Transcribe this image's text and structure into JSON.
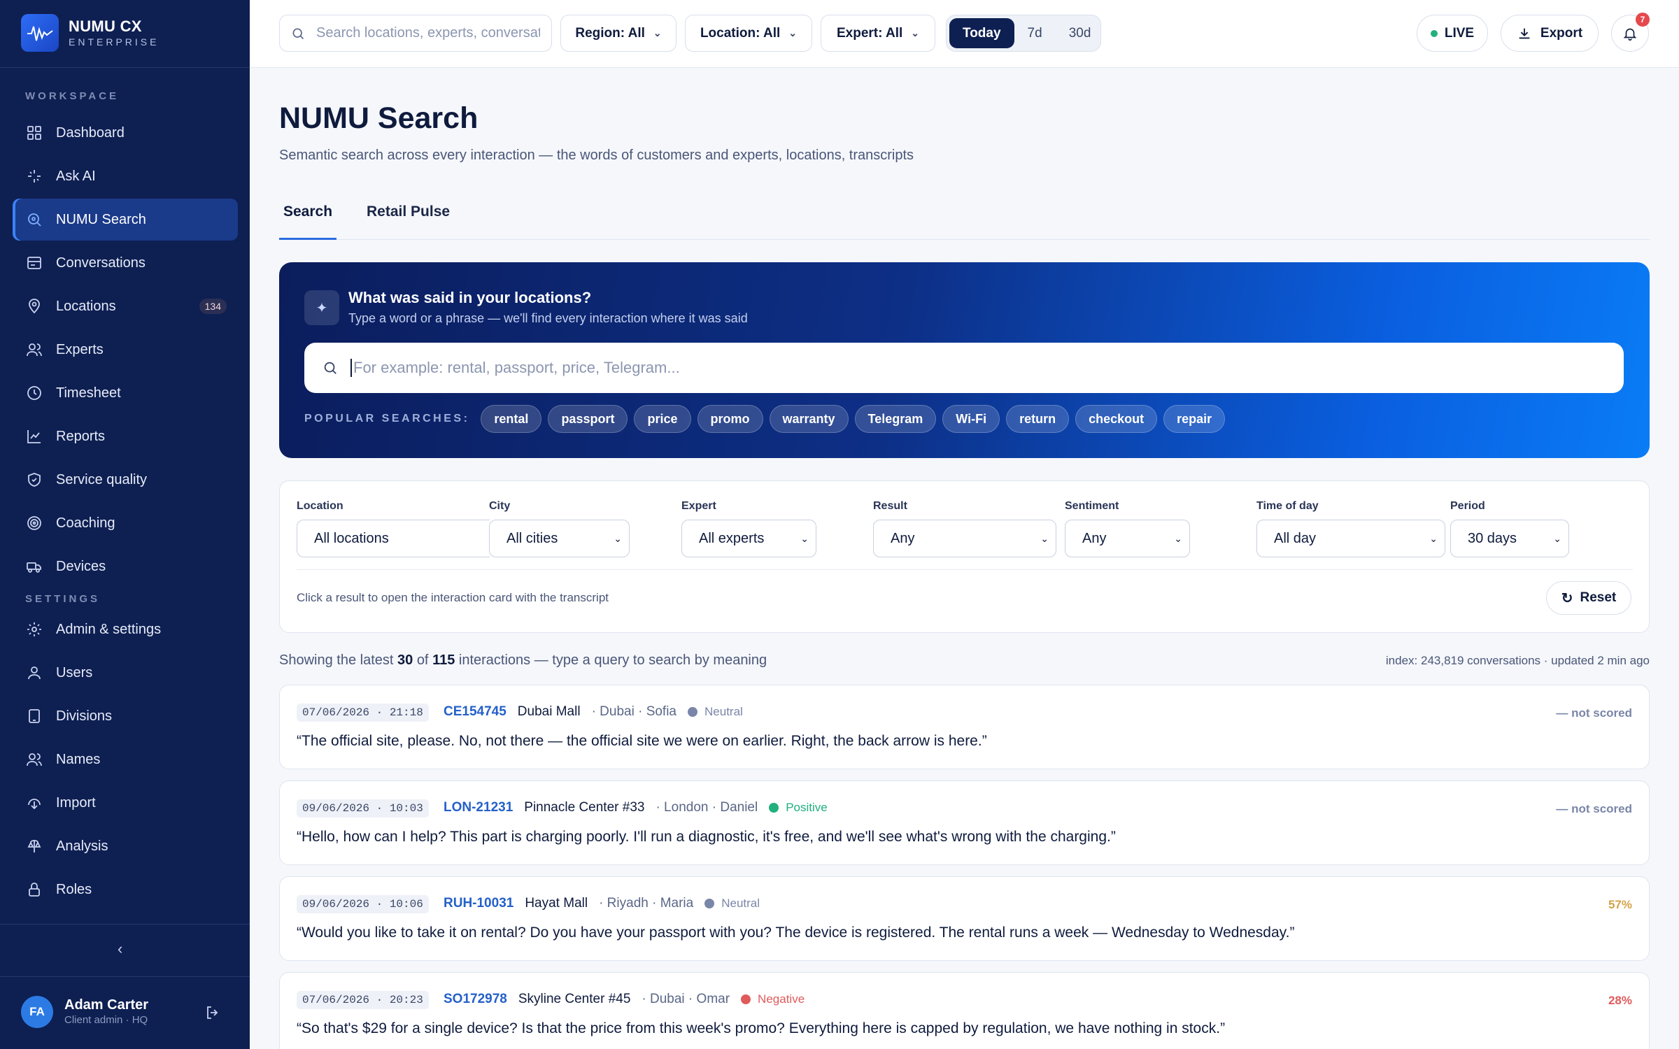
{
  "brand": {
    "name": "NUMU CX",
    "sub": "ENTERPRISE"
  },
  "sidebar": {
    "workspace_label": "WORKSPACE",
    "settings_label": "SETTINGS",
    "workspace_items": [
      {
        "label": "Dashboard",
        "icon": "grid-icon"
      },
      {
        "label": "Ask AI",
        "icon": "sparkle-icon"
      },
      {
        "label": "NUMU Search",
        "icon": "search-icon",
        "active": true
      },
      {
        "label": "Conversations",
        "icon": "inbox-icon"
      },
      {
        "label": "Locations",
        "icon": "map-pin-icon",
        "badge": "134"
      },
      {
        "label": "Experts",
        "icon": "users-icon"
      },
      {
        "label": "Timesheet",
        "icon": "clock-icon"
      },
      {
        "label": "Reports",
        "icon": "chart-line-icon"
      },
      {
        "label": "Service quality",
        "icon": "shield-icon"
      },
      {
        "label": "Coaching",
        "icon": "target-icon"
      },
      {
        "label": "Devices",
        "icon": "truck-icon"
      }
    ],
    "settings_items": [
      {
        "label": "Admin & settings",
        "icon": "gear-icon"
      },
      {
        "label": "Users",
        "icon": "user-icon"
      },
      {
        "label": "Divisions",
        "icon": "tablet-icon"
      },
      {
        "label": "Names",
        "icon": "users-icon"
      },
      {
        "label": "Import",
        "icon": "import-icon"
      },
      {
        "label": "Analysis",
        "icon": "analysis-icon"
      },
      {
        "label": "Roles",
        "icon": "lock-icon"
      }
    ],
    "collapse_icon": "chevron-left-icon",
    "user": {
      "initials": "FA",
      "name": "Adam Carter",
      "role": "Client admin · HQ"
    }
  },
  "topbar": {
    "search_placeholder": "Search locations, experts, conversations",
    "region": "Region: All",
    "location": "Location: All",
    "expert": "Expert: All",
    "ranges": [
      "Today",
      "7d",
      "30d"
    ],
    "active_range": "Today",
    "live": "LIVE",
    "export": "Export",
    "notifications": "7"
  },
  "page": {
    "title": "NUMU Search",
    "subtitle": "Semantic search across every interaction — the words of customers and experts, locations, transcripts",
    "tabs": [
      "Search",
      "Retail Pulse"
    ]
  },
  "hero": {
    "title": "What was said in your locations?",
    "subtitle": "Type a word or a phrase — we'll find every interaction where it was said",
    "placeholder": "For example: rental, passport, price, Telegram...",
    "popular_label": "POPULAR SEARCHES:",
    "chips": [
      "rental",
      "passport",
      "price",
      "promo",
      "warranty",
      "Telegram",
      "Wi-Fi",
      "return",
      "checkout",
      "repair"
    ]
  },
  "filters": {
    "location": {
      "label": "Location",
      "value": "All locations"
    },
    "city": {
      "label": "City",
      "value": "All cities"
    },
    "expert": {
      "label": "Expert",
      "value": "All experts"
    },
    "result": {
      "label": "Result",
      "value": "Any"
    },
    "sentiment": {
      "label": "Sentiment",
      "value": "Any"
    },
    "time_of_day": {
      "label": "Time of day",
      "value": "All day"
    },
    "period": {
      "label": "Period",
      "value": "30 days"
    },
    "hint": "Click a result to open the interaction card with the transcript",
    "reset": "Reset"
  },
  "summary": {
    "prefix": "Showing the latest",
    "shown": "30",
    "of": "of",
    "total": "115",
    "suffix": "interactions — type a query to search by meaning",
    "index": "index: 243,819 conversations · updated 2 min ago"
  },
  "results": [
    {
      "date": "07/06/2026 · 21:18",
      "id": "CE154745",
      "location": "Dubai Mall",
      "city": "· Dubai · Sofia",
      "sentiment": "Neutral",
      "sentiment_color": "#7a86a8",
      "score": "— not scored",
      "score_color": "#7a86a8",
      "quote": "“The official site, please. No, not there — the official site we were on earlier. Right, the back arrow is here.”"
    },
    {
      "date": "09/06/2026 · 10:03",
      "id": "LON-21231",
      "location": "Pinnacle Center #33",
      "city": "· London · Daniel",
      "sentiment": "Positive",
      "sentiment_color": "#22b07d",
      "score": "— not scored",
      "score_color": "#7a86a8",
      "quote": "“Hello, how can I help? This part is charging poorly. I'll run a diagnostic, it's free, and we'll see what's wrong with the charging.”"
    },
    {
      "date": "09/06/2026 · 10:06",
      "id": "RUH-10031",
      "location": "Hayat Mall",
      "city": "· Riyadh · Maria",
      "sentiment": "Neutral",
      "sentiment_color": "#7a86a8",
      "score": "57%",
      "score_color": "#d4a24a",
      "quote": "“Would you like to take it on rental? Do you have your passport with you? The device is registered. The rental runs a week — Wednesday to Wednesday.”"
    },
    {
      "date": "07/06/2026 · 20:23",
      "id": "SO172978",
      "location": "Skyline Center #45",
      "city": "· Dubai · Omar",
      "sentiment": "Negative",
      "sentiment_color": "#e05b5b",
      "score": "28%",
      "score_color": "#e05b5b",
      "quote": "“So that's $29 for a single device? Is that the price from this week's promo? Everything here is capped by regulation, we have nothing in stock.”"
    }
  ]
}
